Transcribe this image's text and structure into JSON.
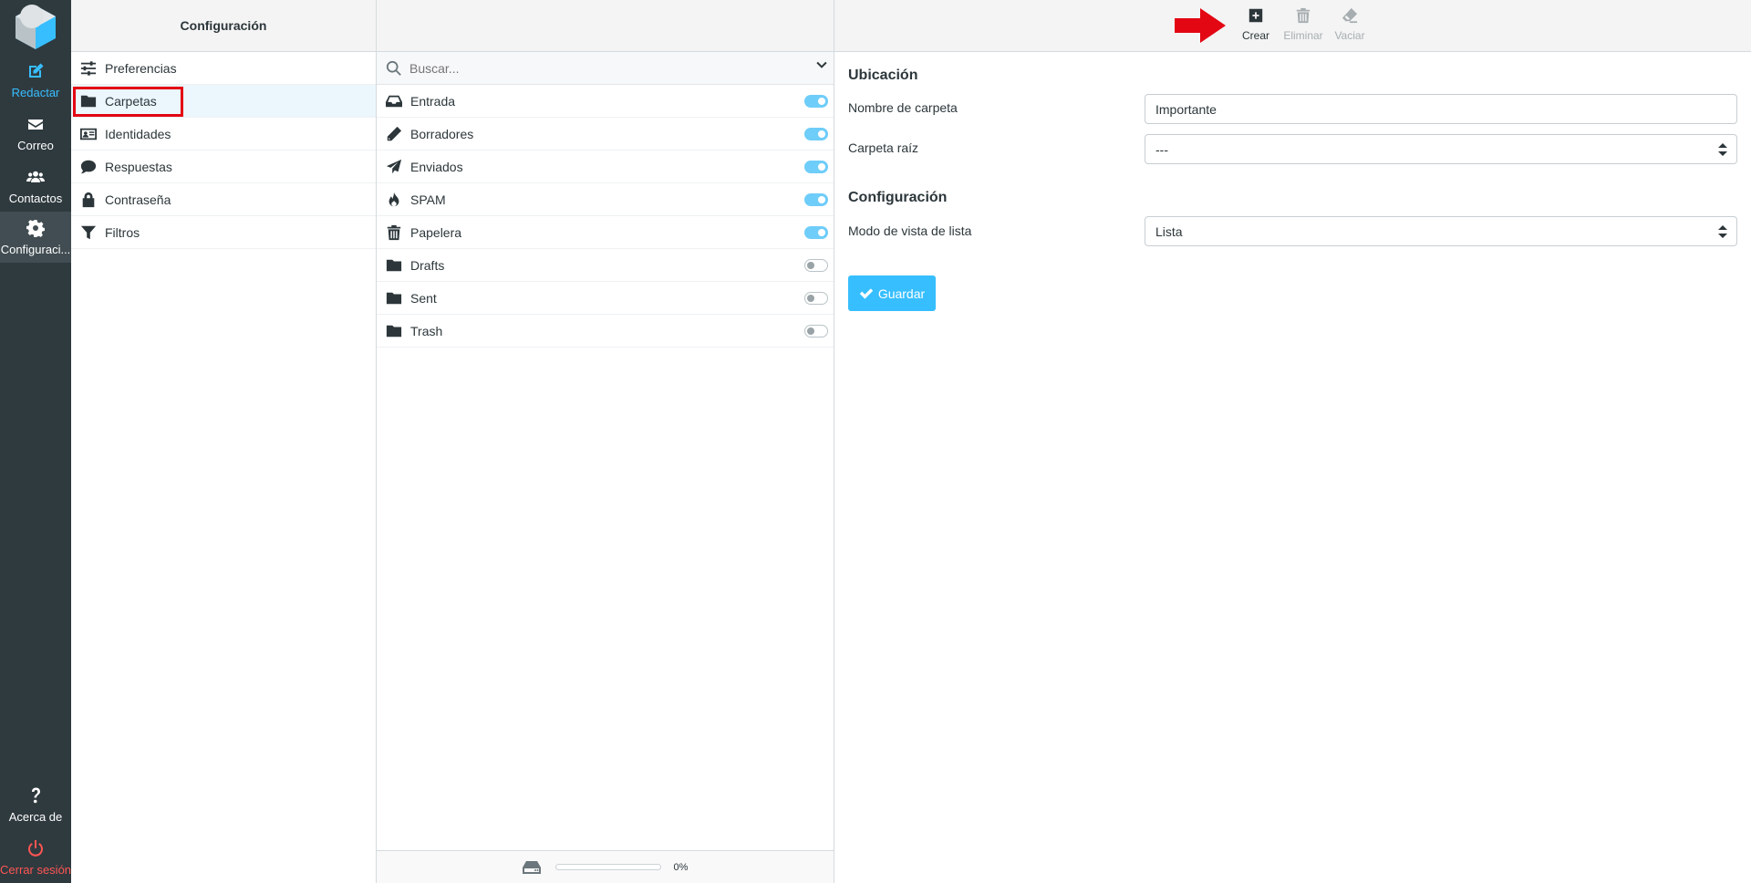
{
  "nav": {
    "items": [
      {
        "label": "Redactar",
        "icon": "compose-icon"
      },
      {
        "label": "Correo",
        "icon": "envelope-icon"
      },
      {
        "label": "Contactos",
        "icon": "users-icon"
      },
      {
        "label": "Configuraci...",
        "icon": "gear-icon"
      }
    ],
    "about": "Acerca de",
    "logout": "Cerrar sesión"
  },
  "settings": {
    "title": "Configuración",
    "sections": [
      {
        "label": "Preferencias",
        "icon": "sliders-icon"
      },
      {
        "label": "Carpetas",
        "icon": "folder-icon"
      },
      {
        "label": "Identidades",
        "icon": "id-card-icon"
      },
      {
        "label": "Respuestas",
        "icon": "comment-icon"
      },
      {
        "label": "Contraseña",
        "icon": "lock-icon"
      },
      {
        "label": "Filtros",
        "icon": "filter-icon"
      }
    ],
    "selected_section": "Carpetas"
  },
  "folders": {
    "search_placeholder": "Buscar...",
    "items": [
      {
        "label": "Entrada",
        "icon": "inbox-icon",
        "subscribed": true
      },
      {
        "label": "Borradores",
        "icon": "pencil-icon",
        "subscribed": true
      },
      {
        "label": "Enviados",
        "icon": "paper-plane-icon",
        "subscribed": true
      },
      {
        "label": "SPAM",
        "icon": "fire-icon",
        "subscribed": true
      },
      {
        "label": "Papelera",
        "icon": "trash-icon",
        "subscribed": true
      },
      {
        "label": "Drafts",
        "icon": "folder-icon",
        "subscribed": false
      },
      {
        "label": "Sent",
        "icon": "folder-icon",
        "subscribed": false
      },
      {
        "label": "Trash",
        "icon": "folder-icon",
        "subscribed": false
      }
    ],
    "quota_text": "0%",
    "quota_fraction": 0
  },
  "toolbar": {
    "create": "Crear",
    "delete": "Eliminar",
    "empty": "Vaciar"
  },
  "form": {
    "location_title": "Ubicación",
    "folder_name_label": "Nombre de carpeta",
    "folder_name_value": "Importante",
    "parent_label": "Carpeta raíz",
    "parent_value": "---",
    "config_title": "Configuración",
    "view_mode_label": "Modo de vista de lista",
    "view_mode_value": "Lista",
    "save": "Guardar"
  },
  "colors": {
    "accent": "#37beff",
    "highlight": "#e30613",
    "nav_bg": "#2f3a3f",
    "logout": "#ff5552"
  }
}
